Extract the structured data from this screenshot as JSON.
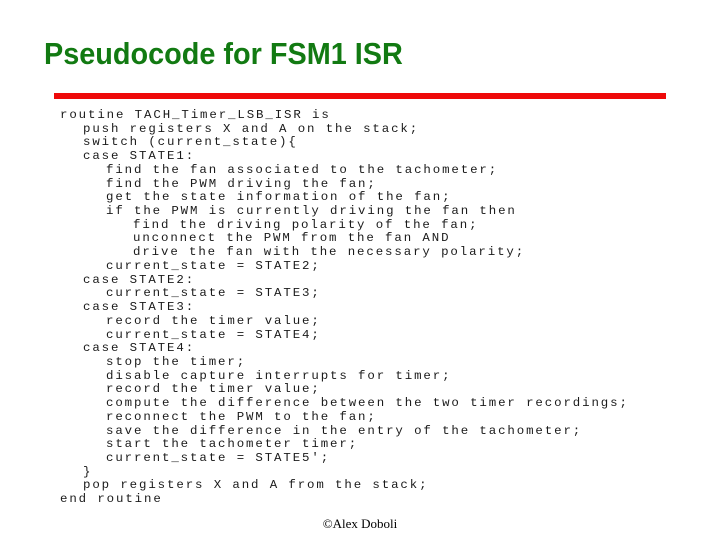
{
  "slide": {
    "title": "Pseudocode for FSM1 ISR",
    "footer": "©Alex Doboli",
    "colors": {
      "title": "#127a12",
      "rule": "#ee0a0a",
      "code_text": "#1a1a1a"
    }
  },
  "code": {
    "lines": [
      {
        "indent": 0,
        "text": "routine TACH_Timer_LSB_ISR is"
      },
      {
        "indent": 1,
        "text": "push registers X and A on the stack;"
      },
      {
        "indent": 1,
        "text": "switch (current_state){"
      },
      {
        "indent": 1,
        "text": "case STATE1:"
      },
      {
        "indent": 2,
        "text": "find the fan associated to the tachometer;"
      },
      {
        "indent": 2,
        "text": "find the PWM driving the fan;"
      },
      {
        "indent": 2,
        "text": "get the state information of the fan;"
      },
      {
        "indent": 2,
        "text": "if the PWM is currently driving the fan then"
      },
      {
        "indent": 3,
        "text": "find the driving polarity of the fan;"
      },
      {
        "indent": 3,
        "text": "unconnect the PWM from the fan AND"
      },
      {
        "indent": 3,
        "text": "drive the fan with the necessary polarity;"
      },
      {
        "indent": 2,
        "text": "current_state = STATE2;"
      },
      {
        "indent": 1,
        "text": "case STATE2:"
      },
      {
        "indent": 2,
        "text": "current_state = STATE3;"
      },
      {
        "indent": 1,
        "text": "case STATE3:"
      },
      {
        "indent": 2,
        "text": "record the timer value;"
      },
      {
        "indent": 2,
        "text": "current_state = STATE4;"
      },
      {
        "indent": 1,
        "text": "case STATE4:"
      },
      {
        "indent": 2,
        "text": "stop the timer;"
      },
      {
        "indent": 2,
        "text": "disable capture interrupts for timer;"
      },
      {
        "indent": 2,
        "text": "record the timer value;"
      },
      {
        "indent": 2,
        "text": "compute the difference between the two timer recordings;"
      },
      {
        "indent": 2,
        "text": "reconnect the PWM to the fan;"
      },
      {
        "indent": 2,
        "text": "save the difference in the entry of the tachometer;"
      },
      {
        "indent": 2,
        "text": "start the tachometer timer;"
      },
      {
        "indent": 2,
        "text": "current_state = STATE5';"
      },
      {
        "indent": 1,
        "text": "}"
      },
      {
        "indent": 1,
        "text": "pop registers X and A from the stack;"
      },
      {
        "indent": 0,
        "text": "end routine"
      }
    ]
  }
}
